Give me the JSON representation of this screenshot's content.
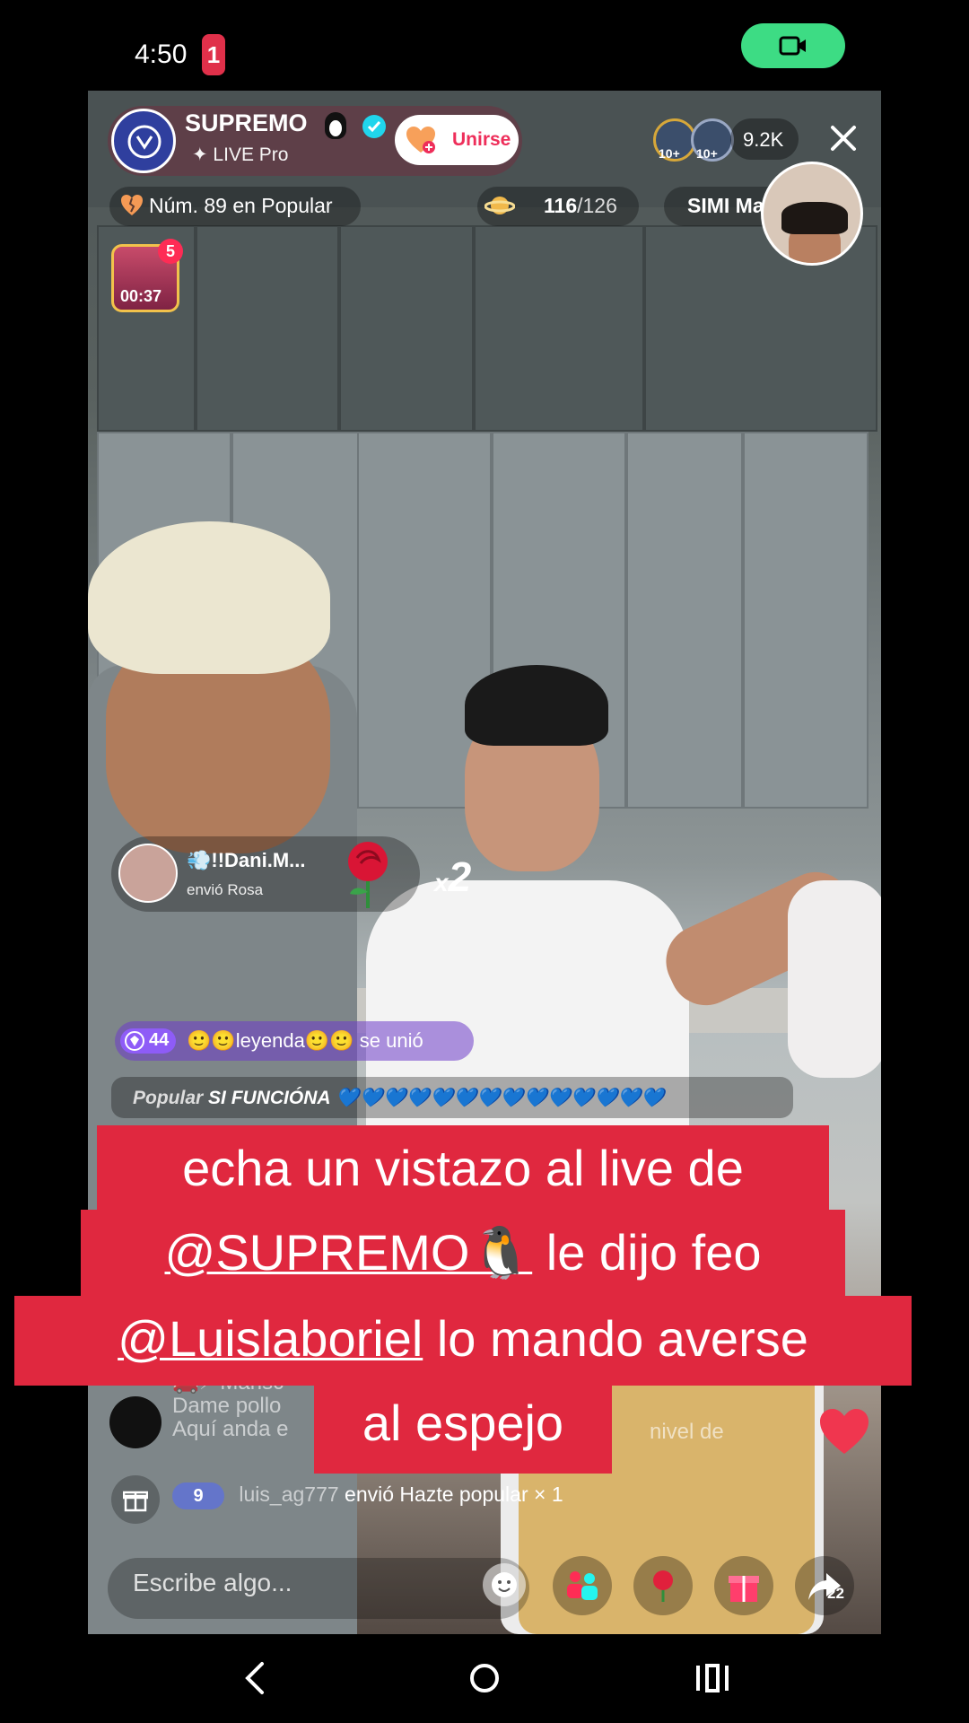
{
  "status_bar": {
    "time": "4:50",
    "notification_count": "1",
    "recording_icon": "video-camera-icon"
  },
  "host": {
    "name": "SUPREMO",
    "badge": "✦ LIVE Pro",
    "join_label": "Unirse"
  },
  "viewers": {
    "top_badges": [
      "10+",
      "10+"
    ],
    "count": "9.2K"
  },
  "ranking": {
    "text": "Núm. 89 en Popular",
    "goal_current": "116",
    "goal_total": "/126",
    "partner_name": "SIMI Ma"
  },
  "treasure": {
    "badge": "5",
    "timer": "00:37"
  },
  "gift_banner": {
    "user": "💨!!Dani.M...",
    "action": "envió Rosa",
    "multiplier_prefix": "x",
    "multiplier": "2"
  },
  "joined": {
    "level": "44",
    "text": "🙂🙂leyenda🙂🙂 se unió"
  },
  "popular_row": {
    "prefix": "Popular",
    "message": "SI FUNCIÓNA",
    "hearts": "💙💙💙💙💙💙💙💙💙💙💙💙💙💙"
  },
  "caption": {
    "line1": "echa un vistazo al live de",
    "line2_mention": "@SUPREMO🐧",
    "line2_rest": "le dijo feo",
    "line3_mention": "@Luislaboriel",
    "line3_rest": "lo mando averse",
    "line4": "al espejo"
  },
  "comments": {
    "line1": "🚗⚡ Marisc",
    "line2": "Dame pollo",
    "line3": "Aquí anda e",
    "line3_end": "nivel de"
  },
  "gift_sent": {
    "level": "9",
    "user": "luis_ag777",
    "text": "envió Hazte popular",
    "multiplier": "× 1"
  },
  "input": {
    "placeholder": "Escribe algo..."
  },
  "share": {
    "count": "22"
  },
  "colors": {
    "accent_red": "#e0283f",
    "tiktok_pink": "#fe2c55",
    "record_green": "#3ddc84",
    "verified_cyan": "#20d5ec"
  }
}
